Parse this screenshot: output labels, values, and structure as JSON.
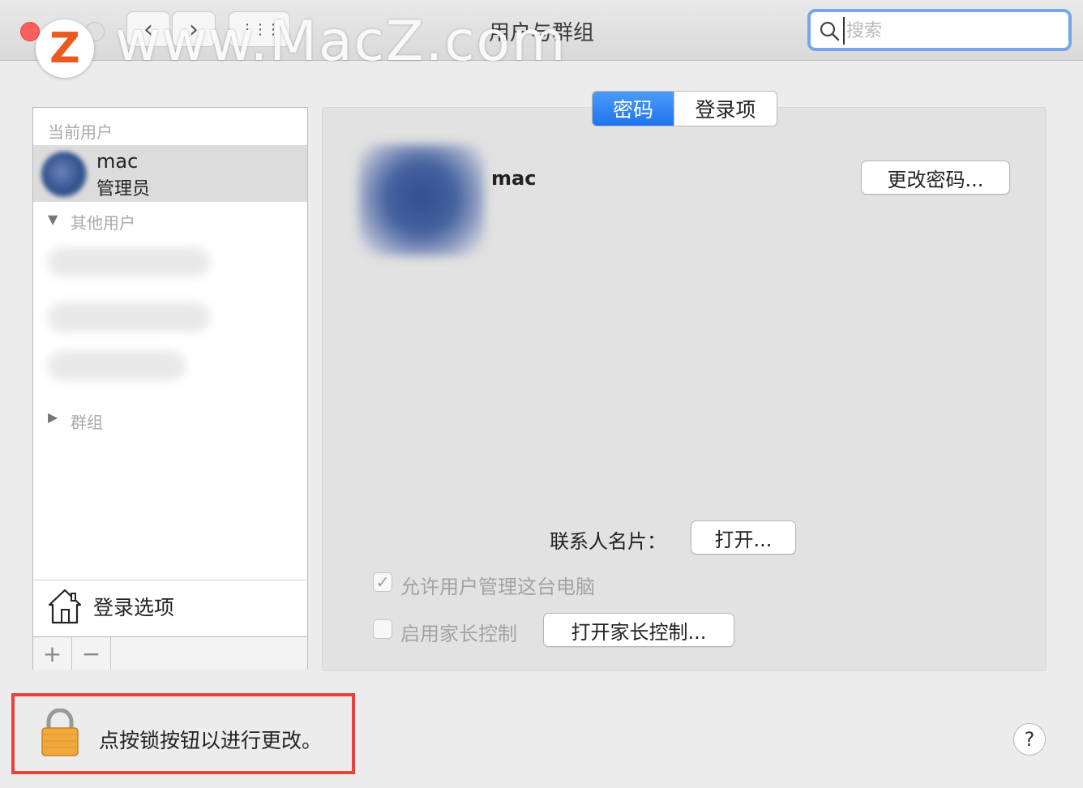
{
  "window": {
    "title": "用户与群组",
    "nav": {
      "back": "‹",
      "forward": "›",
      "grid": "⋮⋮⋮"
    }
  },
  "search": {
    "placeholder": "搜索",
    "value": ""
  },
  "watermark": {
    "logo_letter": "Z",
    "text": "www.MacZ.com"
  },
  "sidebar": {
    "current_section": "当前用户",
    "current_user": {
      "name": "mac",
      "role": "管理员"
    },
    "other_section": "其他用户",
    "groups_section": "群组",
    "login_options": "登录选项",
    "add": "+",
    "remove": "−"
  },
  "tabs": [
    {
      "label": "密码",
      "selected": true
    },
    {
      "label": "登录项",
      "selected": false
    }
  ],
  "main": {
    "user_name": "mac",
    "change_password_button": "更改密码...",
    "contact_card_label": "联系人名片：",
    "open_button": "打开...",
    "allow_admin": {
      "label": "允许用户管理这台电脑",
      "checked": true,
      "enabled": false
    },
    "parental_controls": {
      "label": "启用家长控制",
      "checked": false,
      "enabled": false
    },
    "open_parental_button": "打开家长控制..."
  },
  "footer": {
    "lock_text": "点按锁按钮以进行更改。",
    "help": "?"
  },
  "colors": {
    "accent": "#1f75ee",
    "highlight_box": "#e8423c"
  }
}
